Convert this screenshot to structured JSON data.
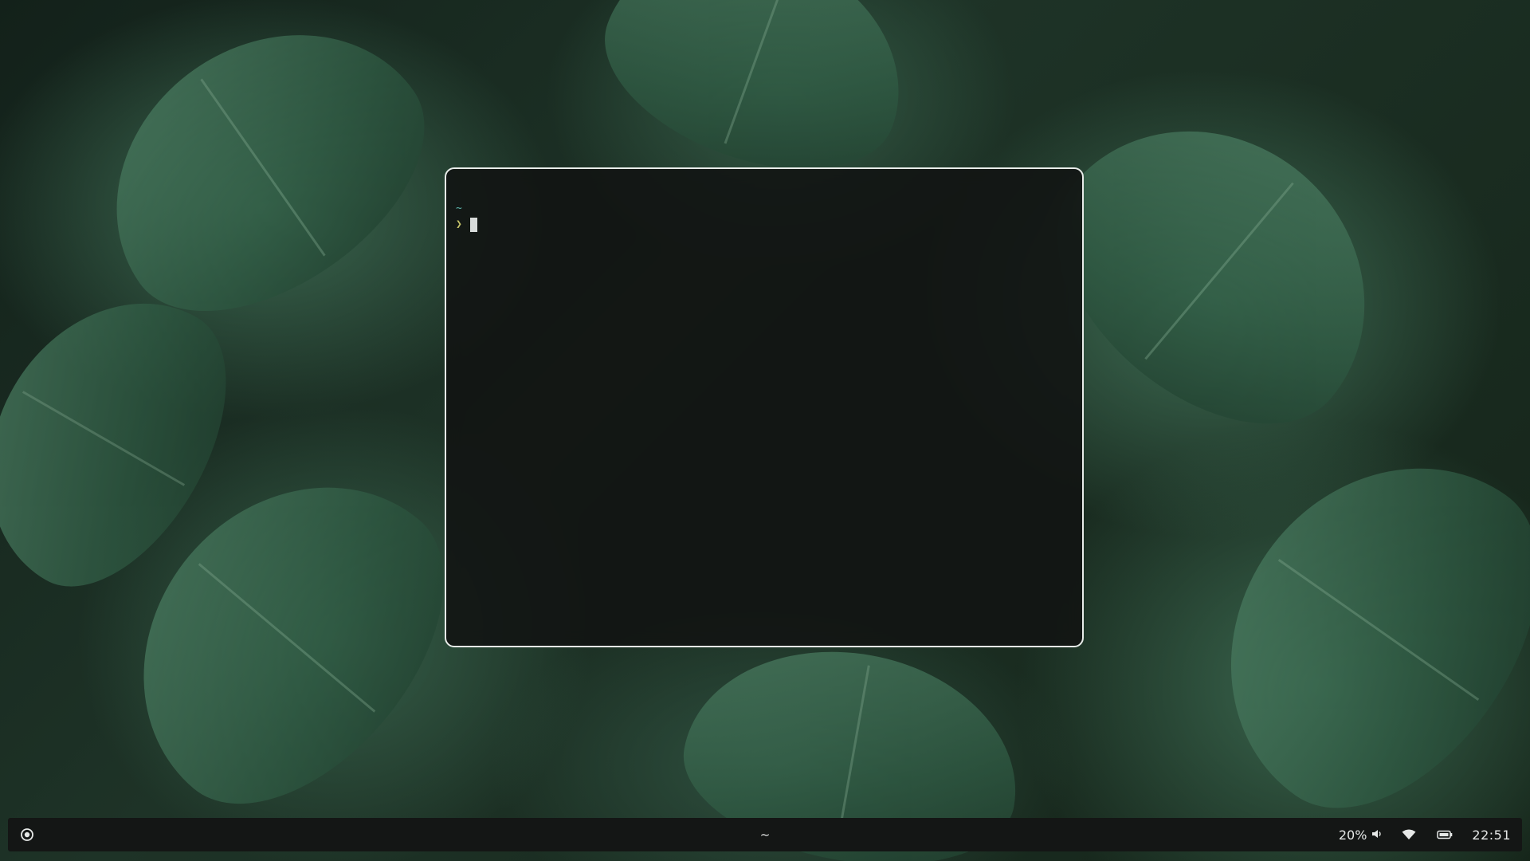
{
  "desktop": {
    "wallpaper": "monstera-leaves",
    "accent_color": "#3f6e55"
  },
  "terminal": {
    "cwd": "~",
    "prompt_symbol": "❯",
    "input": "",
    "border_color": "#e8ece9",
    "cwd_color": "#5fb9b0",
    "prompt_color": "#c8c56a"
  },
  "taskbar": {
    "launcher_icon": "target-icon",
    "active_window_title": "~",
    "volume_percent": "20%",
    "volume_icon": "speaker-icon",
    "wifi_icon": "wifi-icon",
    "battery_icon": "battery-icon",
    "clock": "22:51"
  }
}
